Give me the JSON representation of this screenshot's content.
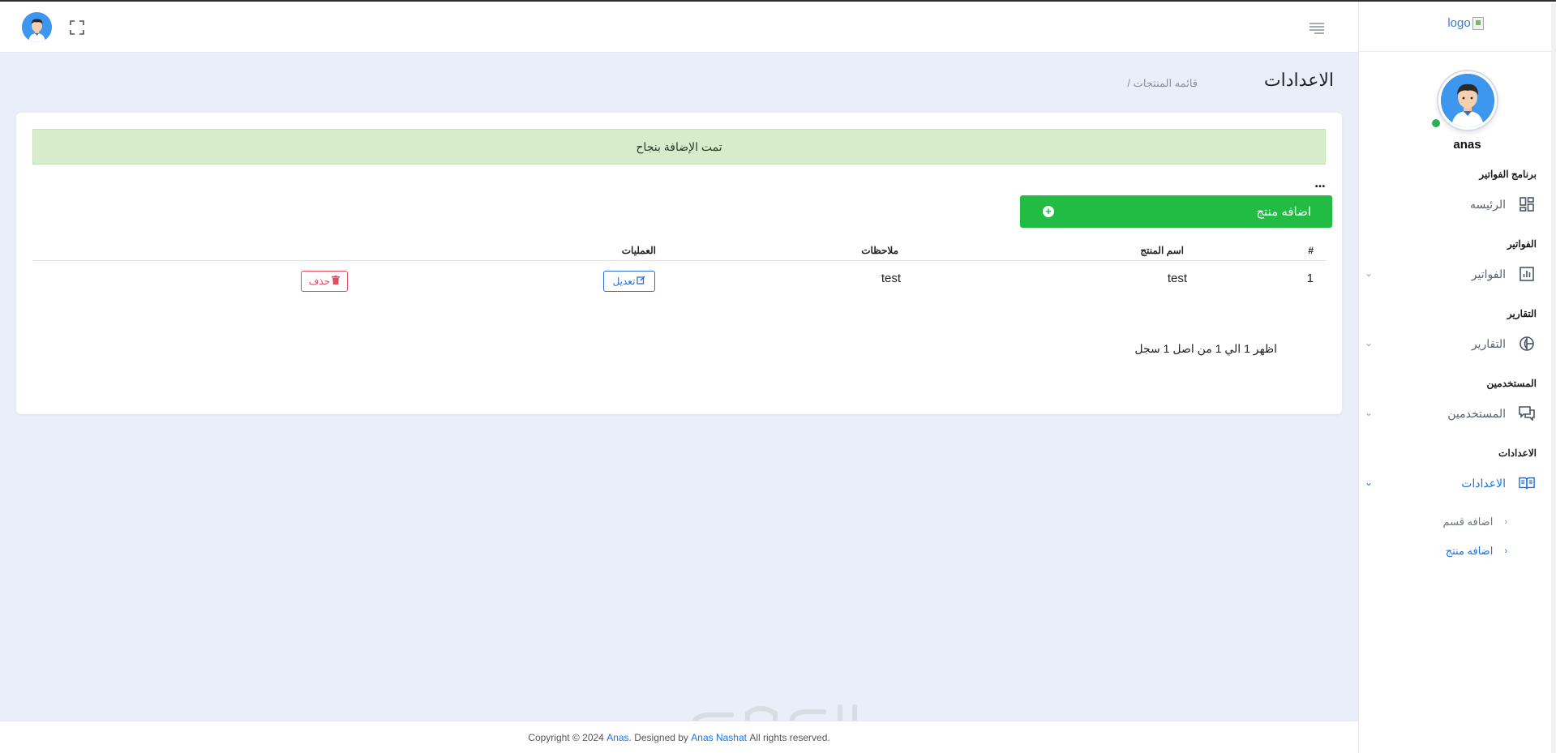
{
  "sidebar": {
    "logo_alt": "logo",
    "user_name": "anas",
    "sections": [
      {
        "title": "برنامج الفواتير",
        "item": "الرئيسه",
        "icon": "dashboard-icon"
      },
      {
        "title": "الفواتير",
        "item": "الفواتير",
        "icon": "bar-chart-icon"
      },
      {
        "title": "التقارير",
        "item": "التقارير",
        "icon": "pie-chart-icon"
      },
      {
        "title": "المستخدمين",
        "item": "المستخدمين",
        "icon": "chat-icon"
      },
      {
        "title": "الاعدادات",
        "item": "الاعدادات",
        "icon": "book-icon"
      }
    ],
    "sub_items": [
      "اضافه قسم",
      "اضافه منتج"
    ],
    "accent": "#1b74e8"
  },
  "page": {
    "title": "الاعدادات",
    "breadcrumb": "/ قائمه المنتجات"
  },
  "alert": {
    "text": "تمت الإضافة بنجاح",
    "bg": "#d6ecca"
  },
  "toolbar": {
    "dots": "...",
    "add_label": "اضافه منتج",
    "add_color": "#22bb44"
  },
  "table": {
    "columns": [
      "#",
      "اسم المنتج",
      "ملاحظات",
      "العمليات"
    ],
    "rows": [
      {
        "num": "1",
        "name": "test",
        "notes": "test",
        "edit_label": "تعديل",
        "delete_label": "حذف"
      }
    ]
  },
  "pagination": {
    "info": "اظهر 1 الي 1 من اصل 1 سجل"
  },
  "footer": {
    "prefix": "Copyright © 2024",
    "brand": "Anas",
    "designed": ". Designed by",
    "designer": "Anas Nashat",
    "suffix": "All rights reserved."
  }
}
